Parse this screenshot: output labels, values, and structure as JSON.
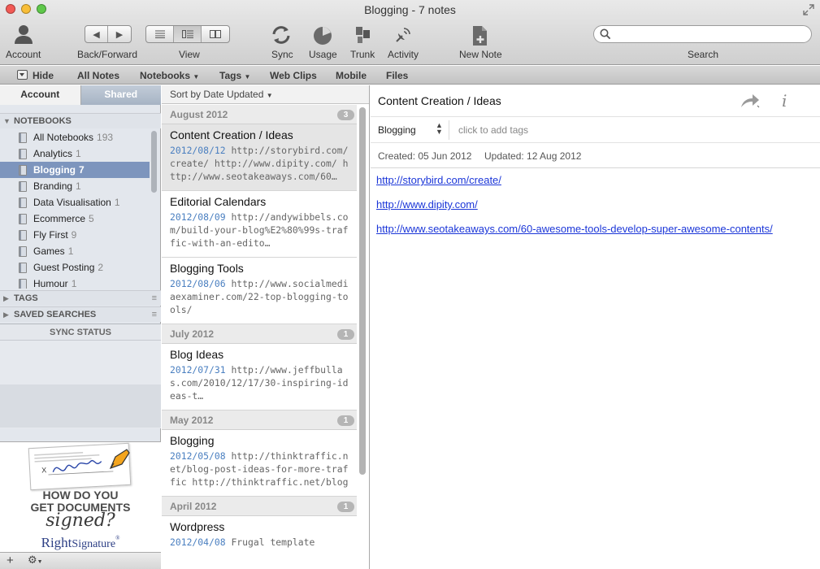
{
  "window": {
    "title": "Blogging - 7 notes"
  },
  "toolbar": {
    "account": "Account",
    "back_forward": "Back/Forward",
    "view": "View",
    "sync": "Sync",
    "usage": "Usage",
    "trunk": "Trunk",
    "activity": "Activity",
    "new_note": "New Note",
    "search_label": "Search",
    "search_value": ""
  },
  "navbar": {
    "hide": "Hide",
    "all_notes": "All Notes",
    "notebooks": "Notebooks",
    "tags": "Tags",
    "web_clips": "Web Clips",
    "mobile": "Mobile",
    "files": "Files"
  },
  "sidebar": {
    "tabs": {
      "account": "Account",
      "shared": "Shared"
    },
    "notebooks_header": "NOTEBOOKS",
    "notebooks": [
      {
        "name": "All Notebooks",
        "count": "193"
      },
      {
        "name": "Analytics",
        "count": "1"
      },
      {
        "name": "Blogging",
        "count": "7",
        "selected": true
      },
      {
        "name": "Branding",
        "count": "1"
      },
      {
        "name": "Data Visualisation",
        "count": "1"
      },
      {
        "name": "Ecommerce",
        "count": "5"
      },
      {
        "name": "Fly First",
        "count": "9"
      },
      {
        "name": "Games",
        "count": "1"
      },
      {
        "name": "Guest Posting",
        "count": "2"
      },
      {
        "name": "Humour",
        "count": "1"
      }
    ],
    "tags_header": "TAGS",
    "saved_searches_header": "SAVED SEARCHES",
    "sync_status": "SYNC STATUS",
    "ad": {
      "line1": "HOW DO YOU",
      "line2": "GET DOCUMENTS",
      "line3": "signed?",
      "brand_right": "Right",
      "brand_signature": "Signature",
      "brand_tm": "®"
    }
  },
  "notelist": {
    "sort": "Sort by Date Updated",
    "groups": [
      {
        "label": "August 2012",
        "count": "3"
      },
      {
        "label": "July 2012",
        "count": "1"
      },
      {
        "label": "May 2012",
        "count": "1"
      },
      {
        "label": "April 2012",
        "count": "1"
      }
    ],
    "notes": [
      {
        "title": "Content Creation / Ideas",
        "date": "2012/08/12",
        "snippet": "http://storybird.com/create/ http://www.dipity.com/ http://www.seotakeaways.com/60…"
      },
      {
        "title": "Editorial Calendars",
        "date": "2012/08/09",
        "snippet": "http://andywibbels.com/build-your-blog%E2%80%99s-traffic-with-an-edito…"
      },
      {
        "title": "Blogging Tools",
        "date": "2012/08/06",
        "snippet": "http://www.socialmediaexaminer.com/22-top-blogging-tools/"
      },
      {
        "title": "Blog Ideas",
        "date": "2012/07/31",
        "snippet": "http://www.jeffbullas.com/2010/12/17/30-inspiring-ideas-t…"
      },
      {
        "title": "Blogging",
        "date": "2012/05/08",
        "snippet": "http://thinktraffic.net/blog-post-ideas-for-more-traffic http://thinktraffic.net/blogging-wi…"
      },
      {
        "title": "Wordpress",
        "date": "2012/04/08",
        "snippet": "Frugal template"
      }
    ]
  },
  "editor": {
    "title": "Content Creation / Ideas",
    "notebook": "Blogging",
    "tags_placeholder": "click to add tags",
    "created": "Created: 05 Jun 2012",
    "updated": "Updated: 12 Aug 2012",
    "links": [
      "http://storybird.com/create/",
      "http://www.dipity.com/",
      "http://www.seotakeaways.com/60-awesome-tools-develop-super-awesome-contents/"
    ]
  },
  "icons": {
    "close": "close-icon",
    "minimize": "minimize-icon",
    "zoom": "zoom-icon",
    "account": "person-icon",
    "back": "back-arrow-icon",
    "forward": "forward-arrow-icon",
    "sync": "sync-icon",
    "usage": "pie-icon",
    "trunk": "trunk-icon",
    "activity": "satellite-icon",
    "new_note": "new-note-icon",
    "search": "search-icon",
    "share": "share-arrow-icon",
    "info": "info-icon"
  },
  "colors": {
    "traffic_close": "#f25a55",
    "traffic_min": "#f8be38",
    "traffic_zoom": "#5fc84a",
    "link": "#1b36d8",
    "date": "#4a7fc0",
    "selected_notebook": "#7d95bd"
  }
}
